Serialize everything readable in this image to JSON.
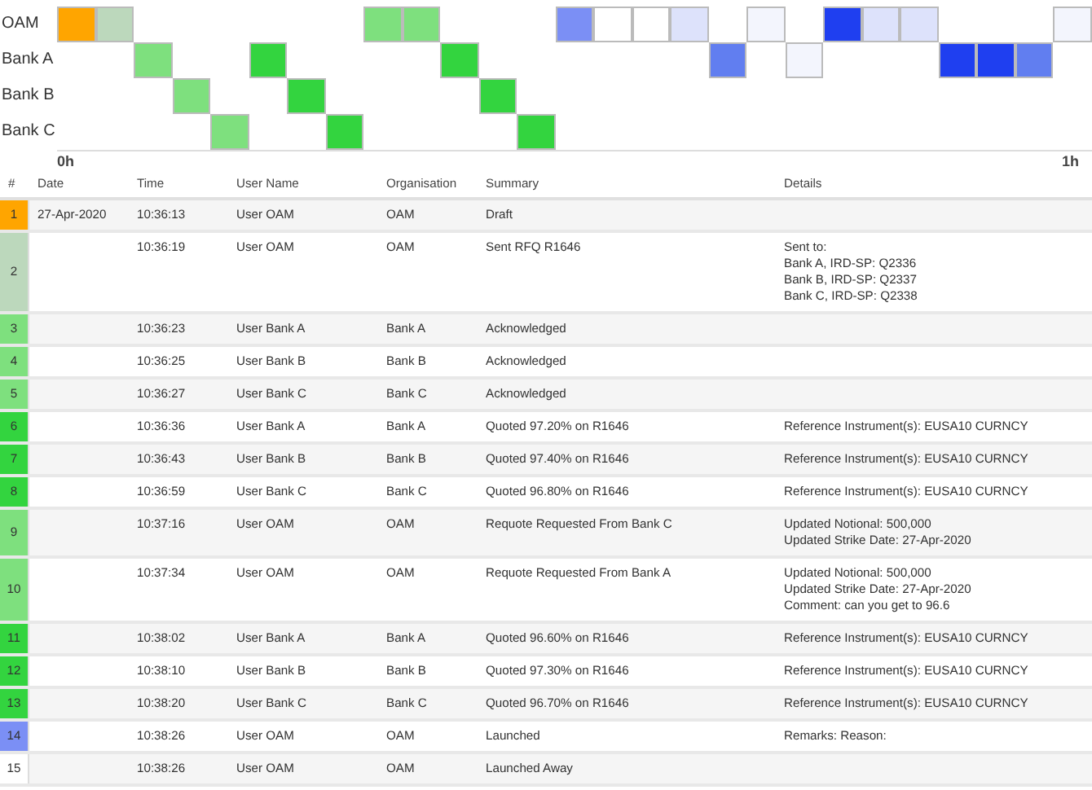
{
  "timeline": {
    "lanes": [
      {
        "label": "OAM",
        "cells": [
          {
            "kind": "event",
            "color": "#ffa500"
          },
          {
            "kind": "event",
            "color": "#bcd8bc"
          },
          {
            "kind": "empty"
          },
          {
            "kind": "empty"
          },
          {
            "kind": "empty"
          },
          {
            "kind": "empty"
          },
          {
            "kind": "empty"
          },
          {
            "kind": "empty"
          },
          {
            "kind": "event",
            "color": "#7ee07e"
          },
          {
            "kind": "event",
            "color": "#7ee07e"
          },
          {
            "kind": "empty"
          },
          {
            "kind": "empty"
          },
          {
            "kind": "empty"
          },
          {
            "kind": "event",
            "color": "#7b8ff5"
          },
          {
            "kind": "event",
            "color": "#ffffff"
          },
          {
            "kind": "event",
            "color": "#ffffff"
          },
          {
            "kind": "event",
            "color": "#dde2fb"
          },
          {
            "kind": "empty"
          },
          {
            "kind": "event",
            "color": "#f3f5fd"
          },
          {
            "kind": "empty"
          },
          {
            "kind": "event",
            "color": "#1f3ff0"
          },
          {
            "kind": "event",
            "color": "#dde2fb"
          },
          {
            "kind": "event",
            "color": "#dde2fb"
          },
          {
            "kind": "empty"
          },
          {
            "kind": "empty"
          },
          {
            "kind": "empty"
          },
          {
            "kind": "event",
            "color": "#f3f5fd"
          }
        ]
      },
      {
        "label": "Bank A",
        "cells": [
          {
            "kind": "empty"
          },
          {
            "kind": "empty"
          },
          {
            "kind": "event",
            "color": "#7ee07e"
          },
          {
            "kind": "empty"
          },
          {
            "kind": "empty"
          },
          {
            "kind": "event",
            "color": "#33d43f"
          },
          {
            "kind": "empty"
          },
          {
            "kind": "empty"
          },
          {
            "kind": "empty"
          },
          {
            "kind": "empty"
          },
          {
            "kind": "event",
            "color": "#33d43f"
          },
          {
            "kind": "empty"
          },
          {
            "kind": "empty"
          },
          {
            "kind": "empty"
          },
          {
            "kind": "empty"
          },
          {
            "kind": "empty"
          },
          {
            "kind": "empty"
          },
          {
            "kind": "event",
            "color": "#617ef0"
          },
          {
            "kind": "empty"
          },
          {
            "kind": "event",
            "color": "#f3f5fd"
          },
          {
            "kind": "empty"
          },
          {
            "kind": "empty"
          },
          {
            "kind": "empty"
          },
          {
            "kind": "event",
            "color": "#1f3ff0"
          },
          {
            "kind": "event",
            "color": "#1f3ff0"
          },
          {
            "kind": "event",
            "color": "#617ef0"
          }
        ]
      },
      {
        "label": "Bank B",
        "cells": [
          {
            "kind": "empty"
          },
          {
            "kind": "empty"
          },
          {
            "kind": "empty"
          },
          {
            "kind": "event",
            "color": "#7ee07e"
          },
          {
            "kind": "empty"
          },
          {
            "kind": "empty"
          },
          {
            "kind": "event",
            "color": "#33d43f"
          },
          {
            "kind": "empty"
          },
          {
            "kind": "empty"
          },
          {
            "kind": "empty"
          },
          {
            "kind": "empty"
          },
          {
            "kind": "event",
            "color": "#33d43f"
          }
        ]
      },
      {
        "label": "Bank C",
        "cells": [
          {
            "kind": "empty"
          },
          {
            "kind": "empty"
          },
          {
            "kind": "empty"
          },
          {
            "kind": "empty"
          },
          {
            "kind": "event",
            "color": "#7ee07e"
          },
          {
            "kind": "empty"
          },
          {
            "kind": "empty"
          },
          {
            "kind": "event",
            "color": "#33d43f"
          },
          {
            "kind": "empty"
          },
          {
            "kind": "empty"
          },
          {
            "kind": "empty"
          },
          {
            "kind": "empty"
          },
          {
            "kind": "event",
            "color": "#33d43f"
          }
        ]
      }
    ],
    "axis_labels": [
      "0h",
      "1h"
    ]
  },
  "table": {
    "columns": [
      "#",
      "Date",
      "Time",
      "User Name",
      "Organisation",
      "Summary",
      "Details"
    ],
    "rows": [
      {
        "number": "1",
        "color": "#ffa500",
        "date": "27-Apr-2020",
        "time": "10:36:13",
        "user": "User OAM",
        "organisation": "OAM",
        "summary": "Draft"
      },
      {
        "number": "2",
        "color": "#bcd8bc",
        "time": "10:36:19",
        "user": "User OAM",
        "organisation": "OAM",
        "summary": "Sent RFQ R1646",
        "details": [
          "Sent to:",
          "Bank A, IRD-SP: Q2336",
          "Bank B, IRD-SP: Q2337",
          "Bank C, IRD-SP: Q2338"
        ]
      },
      {
        "number": "3",
        "color": "#7ee07e",
        "time": "10:36:23",
        "user": "User Bank A",
        "organisation": "Bank A",
        "summary": "Acknowledged"
      },
      {
        "number": "4",
        "color": "#7ee07e",
        "time": "10:36:25",
        "user": "User Bank B",
        "organisation": "Bank B",
        "summary": "Acknowledged"
      },
      {
        "number": "5",
        "color": "#7ee07e",
        "time": "10:36:27",
        "user": "User Bank C",
        "organisation": "Bank C",
        "summary": "Acknowledged"
      },
      {
        "number": "6",
        "color": "#33d43f",
        "time": "10:36:36",
        "user": "User Bank A",
        "organisation": "Bank A",
        "summary": "Quoted 97.20% on R1646",
        "details": [
          "Reference Instrument(s): EUSA10 CURNCY"
        ]
      },
      {
        "number": "7",
        "color": "#33d43f",
        "time": "10:36:43",
        "user": "User Bank B",
        "organisation": "Bank B",
        "summary": "Quoted 97.40% on R1646",
        "details": [
          "Reference Instrument(s): EUSA10 CURNCY"
        ]
      },
      {
        "number": "8",
        "color": "#33d43f",
        "time": "10:36:59",
        "user": "User Bank C",
        "organisation": "Bank C",
        "summary": "Quoted 96.80% on R1646",
        "details": [
          "Reference Instrument(s): EUSA10 CURNCY"
        ]
      },
      {
        "number": "9",
        "color": "#7ee07e",
        "time": "10:37:16",
        "user": "User OAM",
        "organisation": "OAM",
        "summary": "Requote Requested From Bank C",
        "details": [
          "Updated Notional: 500,000",
          "Updated Strike Date: 27-Apr-2020"
        ]
      },
      {
        "number": "10",
        "color": "#7ee07e",
        "time": "10:37:34",
        "user": "User OAM",
        "organisation": "OAM",
        "summary": "Requote Requested From Bank A",
        "details": [
          "Updated Notional: 500,000",
          "Updated Strike Date: 27-Apr-2020",
          "Comment: can you get to 96.6"
        ]
      },
      {
        "number": "11",
        "color": "#33d43f",
        "time": "10:38:02",
        "user": "User Bank A",
        "organisation": "Bank A",
        "summary": "Quoted 96.60% on R1646",
        "details": [
          "Reference Instrument(s): EUSA10 CURNCY"
        ]
      },
      {
        "number": "12",
        "color": "#33d43f",
        "time": "10:38:10",
        "user": "User Bank B",
        "organisation": "Bank B",
        "summary": "Quoted 97.30% on R1646",
        "details": [
          "Reference Instrument(s): EUSA10 CURNCY"
        ]
      },
      {
        "number": "13",
        "color": "#33d43f",
        "time": "10:38:20",
        "user": "User Bank C",
        "organisation": "Bank C",
        "summary": "Quoted 96.70% on R1646",
        "details": [
          "Reference Instrument(s): EUSA10 CURNCY"
        ]
      },
      {
        "number": "14",
        "color": "#7b8ff5",
        "time": "10:38:26",
        "user": "User OAM",
        "organisation": "OAM",
        "summary": "Launched",
        "details": [
          "Remarks: Reason:"
        ]
      },
      {
        "number": "15",
        "color": "#ffffff",
        "time": "10:38:26",
        "user": "User OAM",
        "organisation": "OAM",
        "summary": "Launched Away"
      }
    ]
  }
}
